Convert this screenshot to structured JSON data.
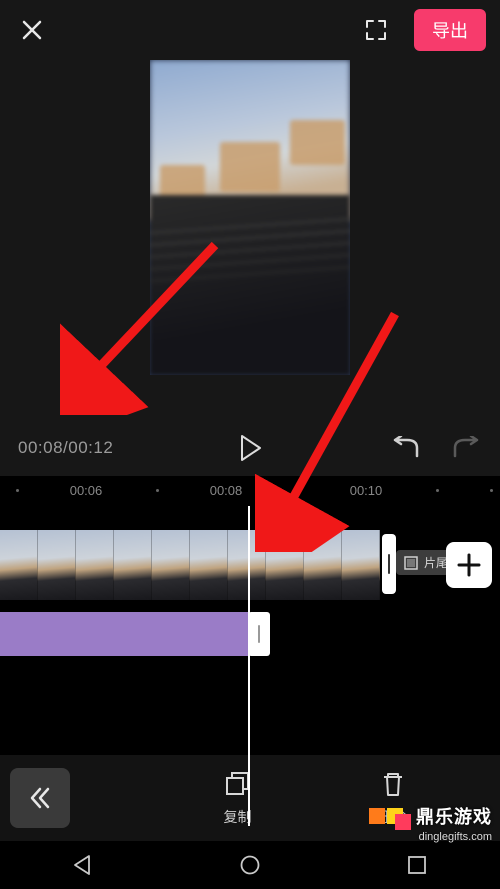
{
  "topbar": {
    "export_label": "导出"
  },
  "controls": {
    "time_display": "00:08/00:12"
  },
  "ruler": {
    "labels": [
      "00:06",
      "00:08",
      "00:10"
    ]
  },
  "timeline": {
    "end_card_label": "片尾"
  },
  "toolbar": {
    "copy_label": "复制",
    "delete_label": "删除"
  },
  "watermark": {
    "brand": "鼎乐游戏",
    "url": "dinglegifts.com"
  },
  "colors": {
    "accent": "#f73b6c",
    "music_track": "#9a7cc7"
  }
}
